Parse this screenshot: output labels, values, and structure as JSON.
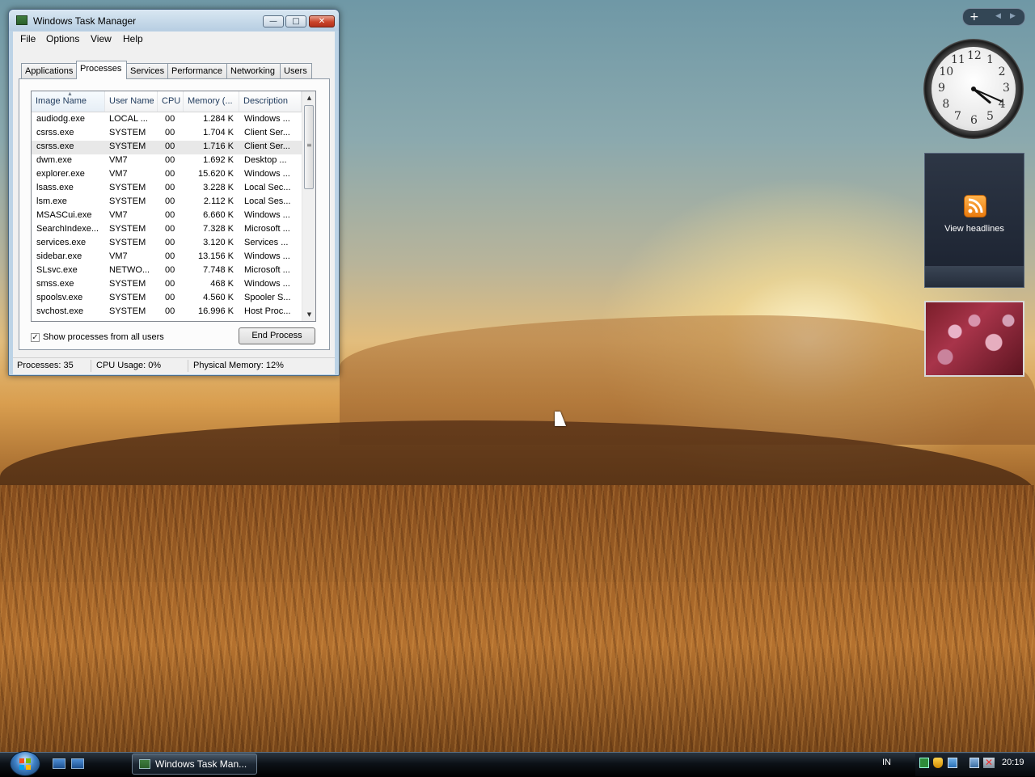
{
  "window": {
    "title": "Windows Task Manager",
    "minimize_glyph": "—",
    "maximize_glyph": "□",
    "close_glyph": "✕"
  },
  "menu": [
    "File",
    "Options",
    "View",
    "Help"
  ],
  "tabs": [
    {
      "label": "Applications",
      "active": false
    },
    {
      "label": "Processes",
      "active": true
    },
    {
      "label": "Services",
      "active": false
    },
    {
      "label": "Performance",
      "active": false
    },
    {
      "label": "Networking",
      "active": false
    },
    {
      "label": "Users",
      "active": false
    }
  ],
  "columns": {
    "image_name": "Image Name",
    "user_name": "User Name",
    "cpu": "CPU",
    "memory": "Memory (...",
    "description": "Description"
  },
  "processes": [
    {
      "name": "audiodg.exe",
      "user": "LOCAL ...",
      "cpu": "00",
      "mem": "1.284 K",
      "desc": "Windows ..."
    },
    {
      "name": "csrss.exe",
      "user": "SYSTEM",
      "cpu": "00",
      "mem": "1.704 K",
      "desc": "Client Ser..."
    },
    {
      "name": "csrss.exe",
      "user": "SYSTEM",
      "cpu": "00",
      "mem": "1.716 K",
      "desc": "Client Ser...",
      "selected": true
    },
    {
      "name": "dwm.exe",
      "user": "VM7",
      "cpu": "00",
      "mem": "1.692 K",
      "desc": "Desktop ..."
    },
    {
      "name": "explorer.exe",
      "user": "VM7",
      "cpu": "00",
      "mem": "15.620 K",
      "desc": "Windows ..."
    },
    {
      "name": "lsass.exe",
      "user": "SYSTEM",
      "cpu": "00",
      "mem": "3.228 K",
      "desc": "Local Sec..."
    },
    {
      "name": "lsm.exe",
      "user": "SYSTEM",
      "cpu": "00",
      "mem": "2.112 K",
      "desc": "Local Ses..."
    },
    {
      "name": "MSASCui.exe",
      "user": "VM7",
      "cpu": "00",
      "mem": "6.660 K",
      "desc": "Windows ..."
    },
    {
      "name": "SearchIndexe...",
      "user": "SYSTEM",
      "cpu": "00",
      "mem": "7.328 K",
      "desc": "Microsoft ..."
    },
    {
      "name": "services.exe",
      "user": "SYSTEM",
      "cpu": "00",
      "mem": "3.120 K",
      "desc": "Services ..."
    },
    {
      "name": "sidebar.exe",
      "user": "VM7",
      "cpu": "00",
      "mem": "13.156 K",
      "desc": "Windows ..."
    },
    {
      "name": "SLsvc.exe",
      "user": "NETWO...",
      "cpu": "00",
      "mem": "7.748 K",
      "desc": "Microsoft ..."
    },
    {
      "name": "smss.exe",
      "user": "SYSTEM",
      "cpu": "00",
      "mem": "468 K",
      "desc": "Windows ..."
    },
    {
      "name": "spoolsv.exe",
      "user": "SYSTEM",
      "cpu": "00",
      "mem": "4.560 K",
      "desc": "Spooler S..."
    },
    {
      "name": "svchost.exe",
      "user": "SYSTEM",
      "cpu": "00",
      "mem": "16.996 K",
      "desc": "Host Proc..."
    }
  ],
  "show_all": {
    "label": "Show processes from all users",
    "checked": true,
    "check_glyph": "✓"
  },
  "end_process_label": "End Process",
  "status": {
    "processes": "Processes: 35",
    "cpu": "CPU Usage: 0%",
    "memory": "Physical Memory: 12%"
  },
  "gadgets": {
    "add_glyph": "+",
    "prev_glyph": "◀",
    "next_glyph": "▶",
    "feed_label": "View headlines",
    "clock_numbers": [
      "12",
      "1",
      "2",
      "3",
      "4",
      "5",
      "6",
      "7",
      "8",
      "9",
      "10",
      "11"
    ],
    "clock_time": {
      "hour": 4,
      "minute": 19
    }
  },
  "taskbar": {
    "task_button_label": "Windows Task Man...",
    "language": "IN",
    "time": "20:19"
  },
  "colors": {
    "selection_row": "#e8e8e8",
    "header_text": "#1e395b",
    "close_button": "#c9442a",
    "rss_orange": "#f08c1e"
  }
}
